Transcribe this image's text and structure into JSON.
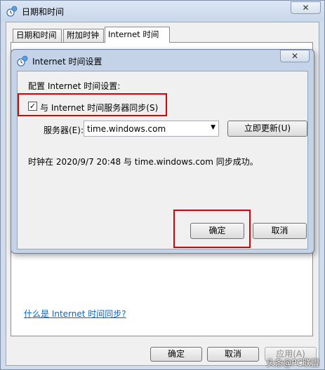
{
  "outer": {
    "title": "日期和时间",
    "close_glyph": "✕",
    "tabs": [
      "日期和时间",
      "附加时钟",
      "Internet 时间"
    ],
    "link": "什么是 Internet 时间同步?",
    "buttons": {
      "ok": "确定",
      "cancel": "取消",
      "apply": "应用(A)"
    }
  },
  "dialog": {
    "title": "Internet 时间设置",
    "close_glyph": "✕",
    "heading": "配置 Internet 时间设置:",
    "sync_checkbox": {
      "label": "与 Internet 时间服务器同步(S)",
      "checked": true,
      "mark": "✓"
    },
    "server_label": "服务器(E):",
    "server_value": "time.windows.com",
    "combo_arrow": "▼",
    "update_button": "立即更新(U)",
    "status": "时钟在 2020/9/7 20:48 与 time.windows.com 同步成功。",
    "ok_button": "确定",
    "cancel_button": "取消"
  },
  "watermark": "头条@PC联盟",
  "colors": {
    "highlight": "#e00000",
    "link": "#0066cc",
    "frame": "#c4d3e8"
  },
  "icons": {
    "window": "clock-globe-icon",
    "dialog": "clock-globe-icon"
  }
}
